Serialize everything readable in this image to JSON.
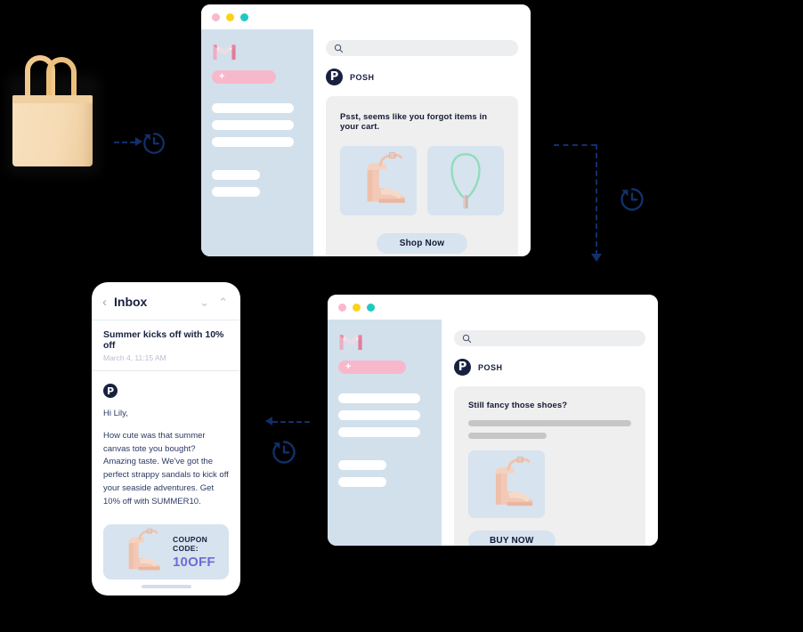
{
  "scene": {
    "title": "Abandoned cart email retargeting flow",
    "background_color": "#000000",
    "accent_navy": "#12306b",
    "accent_pink": "#f7b8cb",
    "accent_blue_tile": "#d7e3ef",
    "accent_purple": "#6f6bd8"
  },
  "tote": {
    "name": "canvas tote bag",
    "color": "#f6dcb6"
  },
  "icons": {
    "history_clock": "history-clock-icon",
    "search": "search-icon",
    "gmail": "gmail-icon",
    "back_chevron": "‹",
    "chevron_down": "⌄",
    "chevron_up": "⌃",
    "plus": "+"
  },
  "window_dots": [
    {
      "name": "close",
      "color": "#f9b8cd"
    },
    {
      "name": "minimize",
      "color": "#fbd21a"
    },
    {
      "name": "maximize",
      "color": "#1fc9c0"
    }
  ],
  "window_top": {
    "sidebar": {
      "compose_label": "+",
      "nav_items": [
        "",
        "",
        ""
      ],
      "nav_items_short": [
        "",
        ""
      ]
    },
    "search": {
      "placeholder": "",
      "value": ""
    },
    "brand": {
      "initial": "P",
      "name": "POSH"
    },
    "email": {
      "heading": "Psst, seems like you forgot items in your cart.",
      "products": [
        {
          "name": "strappy platform sandal",
          "alt": "pink platform heel"
        },
        {
          "name": "beaded pendant necklace",
          "alt": "mint beaded necklace"
        }
      ],
      "cta_label": "Shop Now"
    }
  },
  "window_bottom": {
    "sidebar": {
      "compose_label": "+",
      "nav_items": [
        "",
        "",
        ""
      ],
      "nav_items_short": [
        "",
        ""
      ]
    },
    "search": {
      "placeholder": "",
      "value": ""
    },
    "brand": {
      "initial": "P",
      "name": "POSH"
    },
    "email": {
      "heading": "Still fancy those shoes?",
      "body_skeleton_lines": 2,
      "products": [
        {
          "name": "strappy platform sandal",
          "alt": "pink platform heel"
        }
      ],
      "cta_label": "BUY NOW"
    }
  },
  "phone": {
    "header": {
      "back": "‹",
      "title": "Inbox",
      "prev": "⌄",
      "next": "⌃"
    },
    "message": {
      "subject": "Summer kicks off with 10% off",
      "timestamp": "March 4, 11:15 AM",
      "sender_initial": "P",
      "greeting": "Hi Lily,",
      "body": "How cute was that summer canvas tote you bought? Amazing taste. We've got the perfect strappy sandals to kick off your seaside adventures. Get 10% off with SUMMER10.",
      "coupon": {
        "label": "COUPON CODE:",
        "code": "10OFF",
        "image_alt": "pink platform heel"
      }
    }
  },
  "connectors": [
    {
      "name": "tote-to-clock",
      "direction": "right",
      "style": "dashed"
    },
    {
      "name": "window-top-to-window-bottom",
      "direction": "down",
      "style": "dashed"
    },
    {
      "name": "window-bottom-to-phone",
      "direction": "left",
      "style": "dashed"
    }
  ]
}
